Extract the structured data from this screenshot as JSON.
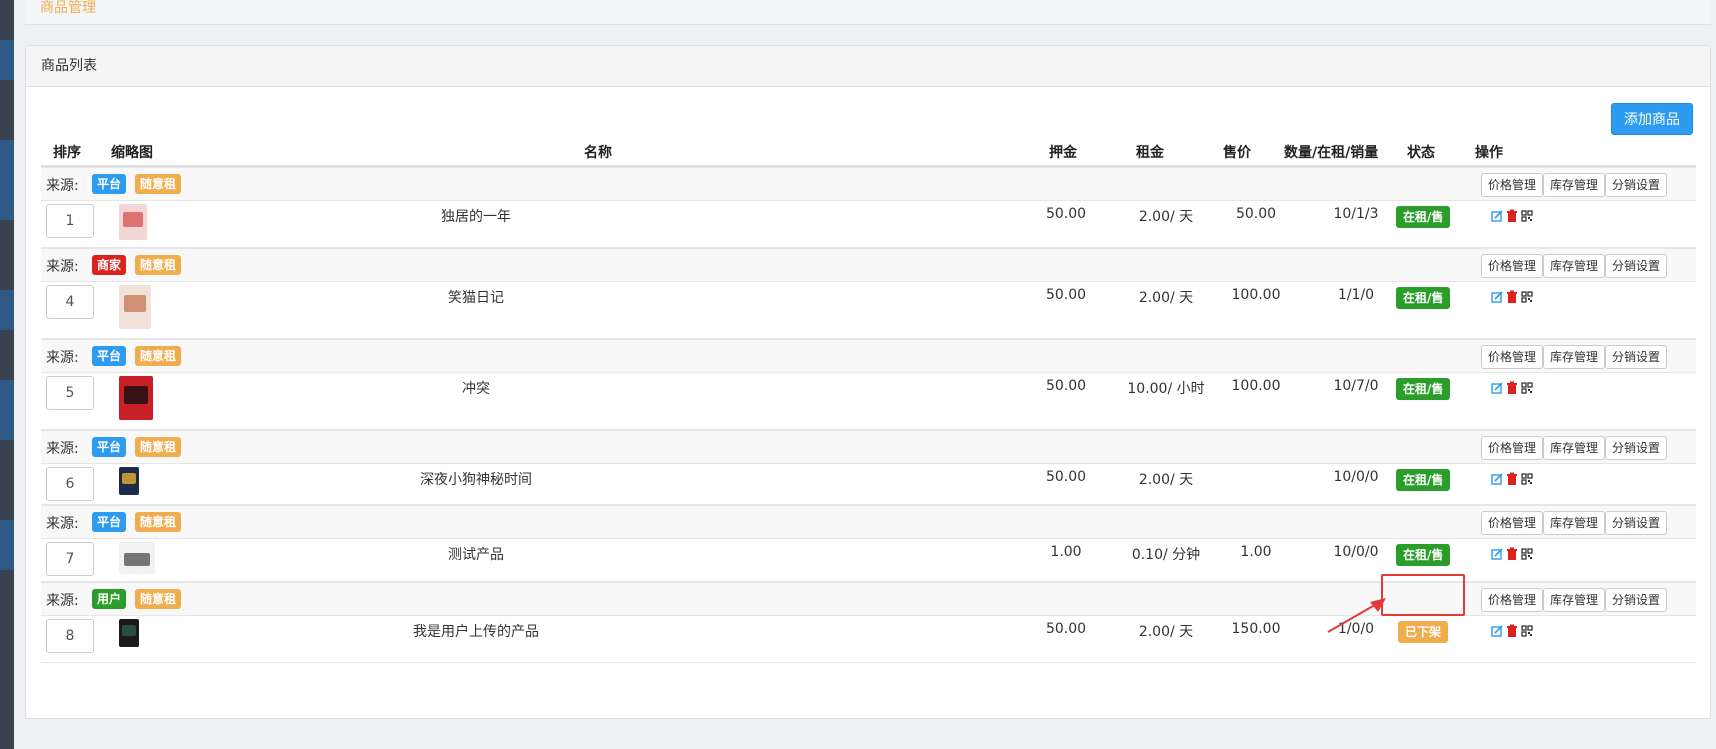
{
  "breadcrumb": {
    "title": "商品管理"
  },
  "panel": {
    "title": "商品列表",
    "add_button": "添加商品"
  },
  "table": {
    "headers": {
      "sort": "排序",
      "thumb": "缩略图",
      "name": "名称",
      "deposit": "押金",
      "rent": "租金",
      "price": "售价",
      "qty": "数量/在租/销量",
      "status": "状态",
      "ops": "操作"
    },
    "source_label": "来源:",
    "row_buttons": {
      "price_mgmt": "价格管理",
      "stock_mgmt": "库存管理",
      "dist_setting": "分销设置"
    },
    "rows": [
      {
        "source": "平台",
        "source_color": "#2d9cf0",
        "mode": "随意租",
        "sort": "1",
        "name": "独居的一年",
        "deposit": "50.00",
        "rent": "2.00/ 天",
        "price": "50.00",
        "qty": "10/1/3",
        "status": "在租/售",
        "status_color": "#2a9d2a"
      },
      {
        "source": "商家",
        "source_color": "#d9231c",
        "mode": "随意租",
        "sort": "4",
        "name": "笑猫日记",
        "deposit": "50.00",
        "rent": "2.00/ 天",
        "price": "100.00",
        "qty": "1/1/0",
        "status": "在租/售",
        "status_color": "#2a9d2a"
      },
      {
        "source": "平台",
        "source_color": "#2d9cf0",
        "mode": "随意租",
        "sort": "5",
        "name": "冲突",
        "deposit": "50.00",
        "rent": "10.00/ 小时",
        "price": "100.00",
        "qty": "10/7/0",
        "status": "在租/售",
        "status_color": "#2a9d2a"
      },
      {
        "source": "平台",
        "source_color": "#2d9cf0",
        "mode": "随意租",
        "sort": "6",
        "name": "深夜小狗神秘时间",
        "deposit": "50.00",
        "rent": "2.00/ 天",
        "price": "",
        "qty": "10/0/0",
        "status": "在租/售",
        "status_color": "#2a9d2a"
      },
      {
        "source": "平台",
        "source_color": "#2d9cf0",
        "mode": "随意租",
        "sort": "7",
        "name": "测试产品",
        "deposit": "1.00",
        "rent": "0.10/ 分钟",
        "price": "1.00",
        "qty": "10/0/0",
        "status": "在租/售",
        "status_color": "#2a9d2a"
      },
      {
        "source": "用户",
        "source_color": "#2a9d2a",
        "mode": "随意租",
        "sort": "8",
        "name": "我是用户上传的产品",
        "deposit": "50.00",
        "rent": "2.00/ 天",
        "price": "150.00",
        "qty": "1/0/0",
        "status": "已下架",
        "status_color": "#f0ad4e"
      }
    ]
  },
  "icons": {
    "edit": "edit-icon",
    "delete": "trash-icon",
    "qr": "qr-code-icon"
  },
  "colors": {
    "accent": "#2d9cf0",
    "annotation": "#e53935"
  }
}
